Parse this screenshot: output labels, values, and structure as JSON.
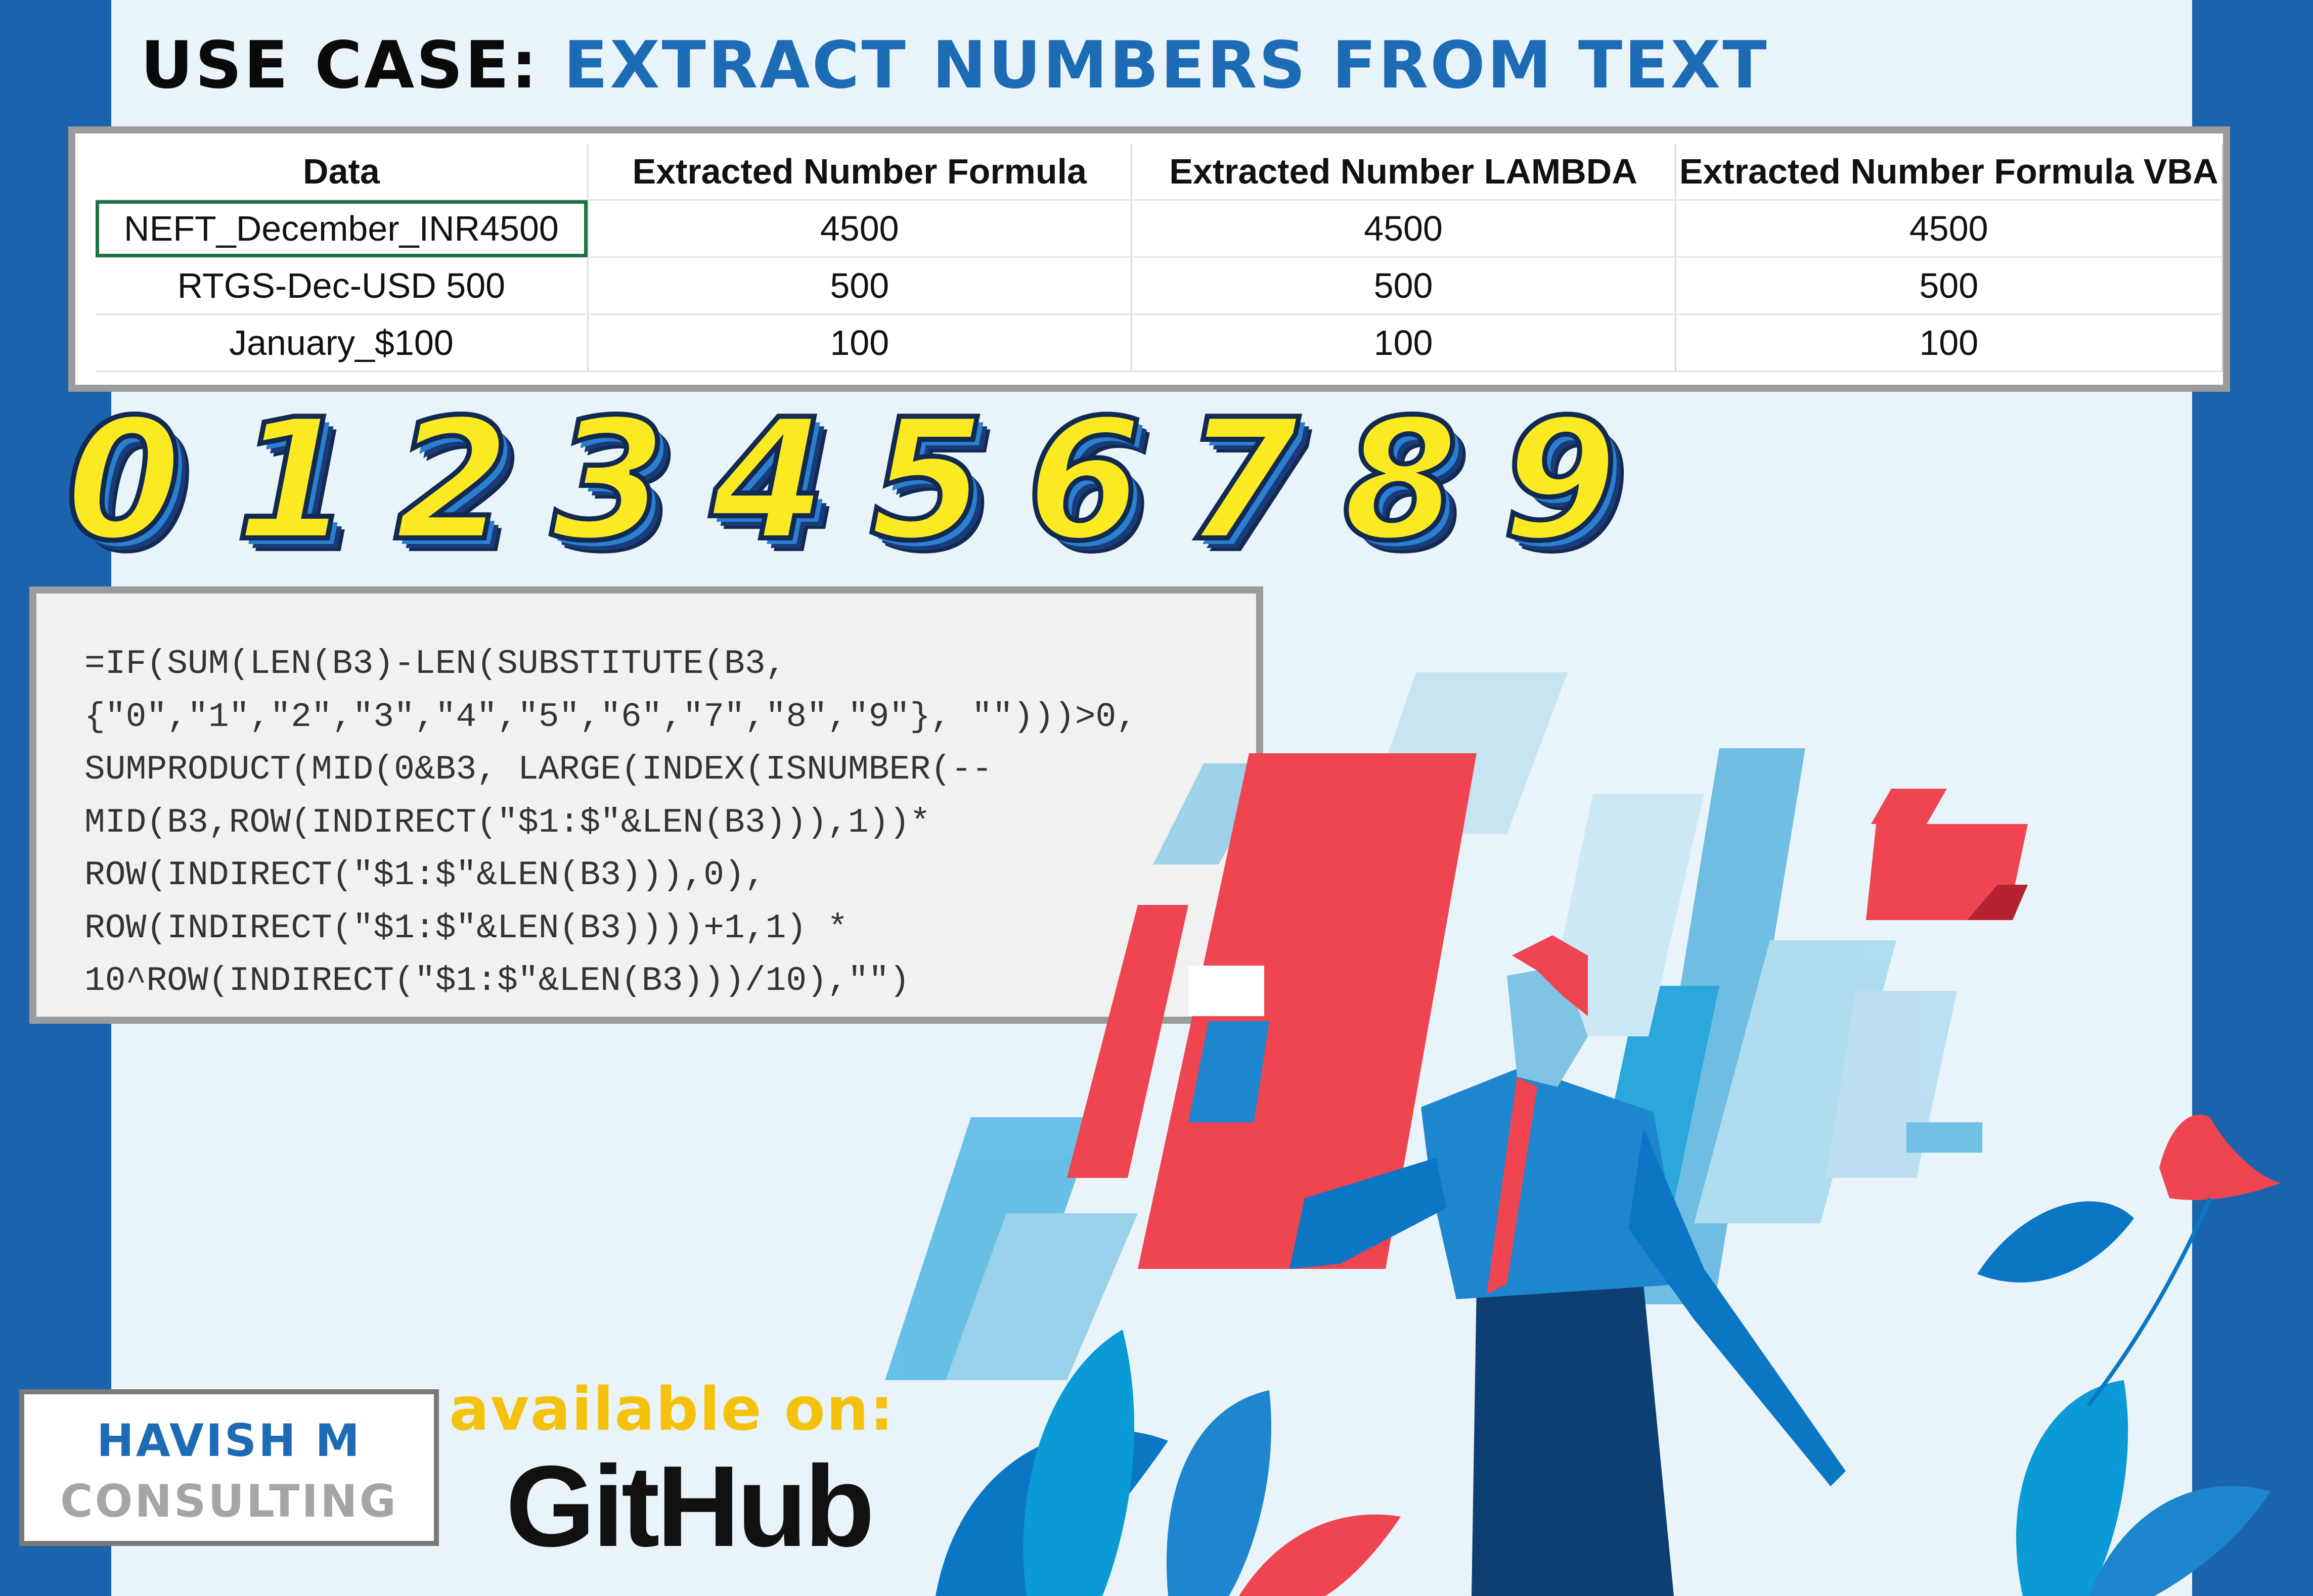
{
  "title": {
    "prefix": "USE CASE:",
    "accent": "EXTRACT NUMBERS FROM TEXT"
  },
  "table": {
    "columns": [
      "Data",
      "Extracted Number Formula",
      "Extracted Number LAMBDA",
      "Extracted Number Formula VBA"
    ],
    "rows": [
      [
        "NEFT_December_INR4500",
        "4500",
        "4500",
        "4500"
      ],
      [
        "RTGS-Dec-USD 500",
        "500",
        "500",
        "500"
      ],
      [
        "January_$100",
        "100",
        "100",
        "100"
      ]
    ]
  },
  "digits": [
    "0",
    "1",
    "2",
    "3",
    "4",
    "5",
    "6",
    "7",
    "8",
    "9"
  ],
  "formula": "=IF(SUM(LEN(B3)-LEN(SUBSTITUTE(B3,\n{\"0\",\"1\",\"2\",\"3\",\"4\",\"5\",\"6\",\"7\",\"8\",\"9\"}, \"\")))>0,\nSUMPRODUCT(MID(0&B3, LARGE(INDEX(ISNUMBER(--\nMID(B3,ROW(INDIRECT(\"$1:$\"&LEN(B3))),1))*\nROW(INDIRECT(\"$1:$\"&LEN(B3))),0),\nROW(INDIRECT(\"$1:$\"&LEN(B3))))+1,1) *\n10^ROW(INDIRECT(\"$1:$\"&LEN(B3)))/10),\"\")",
  "logo": {
    "name": "HAVISH M",
    "subtitle": "CONSULTING"
  },
  "available_label": "available on:",
  "github_label": "GitHub",
  "colors": {
    "background_blue": "#1b64ad",
    "panel": "#e9f4fa",
    "title_accent": "#1c6bb4",
    "digit_fill": "#fbea21",
    "illustration_red": "#ef4550",
    "available_yellow": "#f4c20d"
  }
}
